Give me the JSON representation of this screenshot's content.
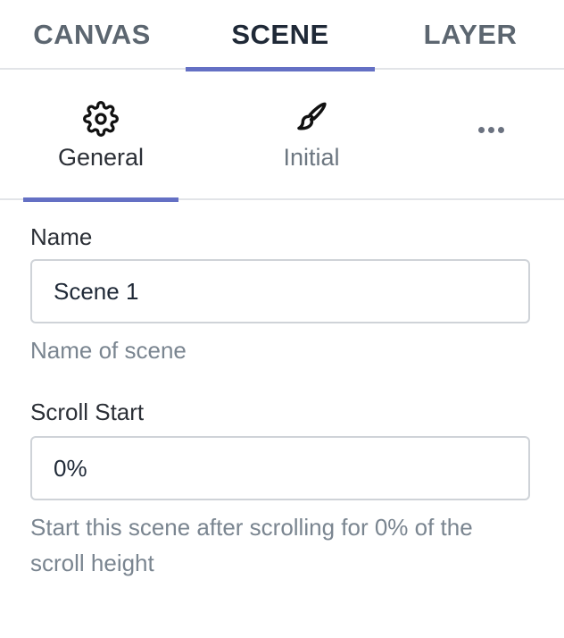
{
  "top_tabs": [
    {
      "label": "CANVAS"
    },
    {
      "label": "SCENE"
    },
    {
      "label": "LAYER"
    }
  ],
  "sub_tabs": [
    {
      "label": "General",
      "icon": "gear-icon"
    },
    {
      "label": "Initial",
      "icon": "brush-icon"
    },
    {
      "label": "",
      "icon": "more-icon"
    }
  ],
  "fields": {
    "name": {
      "label": "Name",
      "value": "Scene 1",
      "help": "Name of scene"
    },
    "scroll_start": {
      "label": "Scroll Start",
      "value": "0%",
      "help": "Start this scene after scrolling for 0% of the scroll height"
    }
  },
  "colors": {
    "accent": "#6470c4",
    "divider": "#e2e4e8",
    "muted_text": "#7a8590"
  }
}
